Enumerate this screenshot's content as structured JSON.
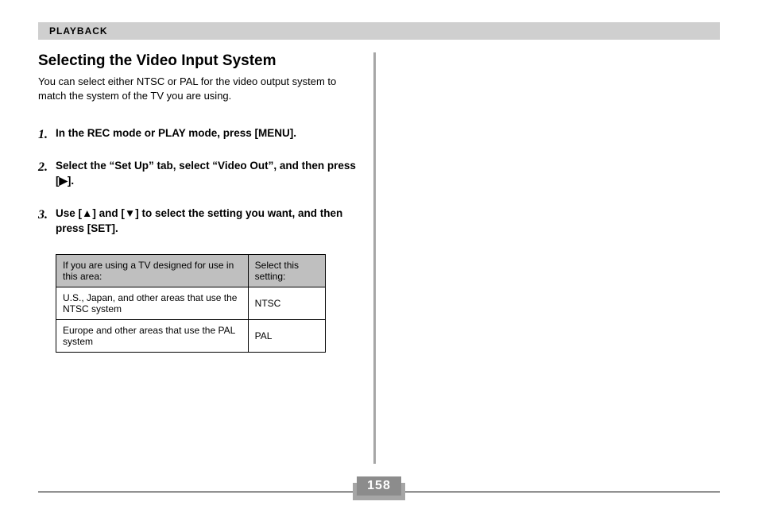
{
  "header": {
    "section": "PLAYBACK"
  },
  "article": {
    "title": "Selecting the Video Input System",
    "intro": "You can select either NTSC or PAL for the video output system to match the system of the TV you are using.",
    "steps": [
      "In the REC mode or PLAY mode, press [MENU].",
      "Select the “Set Up” tab, select “Video Out”, and then press [▶].",
      "Use [▲] and [▼] to select the setting you want, and then press [SET]."
    ],
    "table": {
      "head": {
        "col1": "If you are using a TV designed for use in this area:",
        "col2": "Select this setting:"
      },
      "rows": [
        {
          "area": "U.S., Japan, and other areas that use the NTSC system",
          "setting": "NTSC"
        },
        {
          "area": "Europe and other areas that use the PAL system",
          "setting": "PAL"
        }
      ]
    }
  },
  "page_number": "158"
}
